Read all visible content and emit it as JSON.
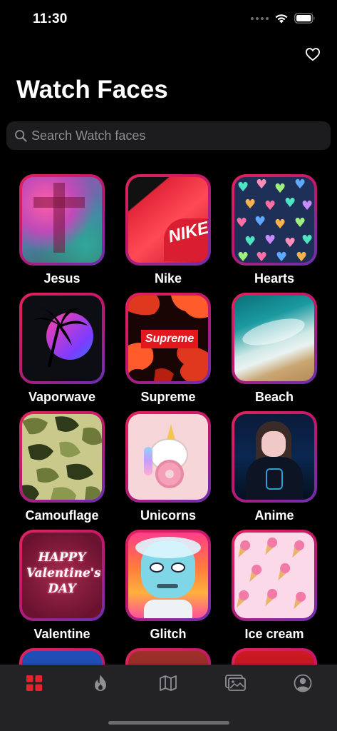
{
  "status_bar": {
    "time": "11:30"
  },
  "header": {
    "title": "Watch Faces"
  },
  "search": {
    "placeholder": "Search Watch faces"
  },
  "tiles": [
    {
      "label": "Jesus"
    },
    {
      "label": "Nike"
    },
    {
      "label": "Hearts"
    },
    {
      "label": "Vaporwave"
    },
    {
      "label": "Supreme"
    },
    {
      "label": "Beach"
    },
    {
      "label": "Camouflage"
    },
    {
      "label": "Unicorns"
    },
    {
      "label": "Anime"
    },
    {
      "label": "Valentine"
    },
    {
      "label": "Glitch"
    },
    {
      "label": "Ice cream"
    }
  ],
  "tile_art_text": {
    "nike": "NIKE",
    "supreme": "Supreme",
    "valentine": "HAPPY Valentine's DAY"
  },
  "tab_bar": {
    "items": [
      {
        "icon": "grid-icon",
        "selected": true
      },
      {
        "icon": "flame-icon",
        "selected": false
      },
      {
        "icon": "map-icon",
        "selected": false
      },
      {
        "icon": "photos-icon",
        "selected": false
      },
      {
        "icon": "profile-icon",
        "selected": false
      }
    ],
    "accent_color": "#e5232c",
    "inactive_color": "#8e8e93"
  },
  "colors": {
    "background": "#000000",
    "tile_border_start": "#e1245c",
    "tile_border_end": "#6a2fb0"
  }
}
